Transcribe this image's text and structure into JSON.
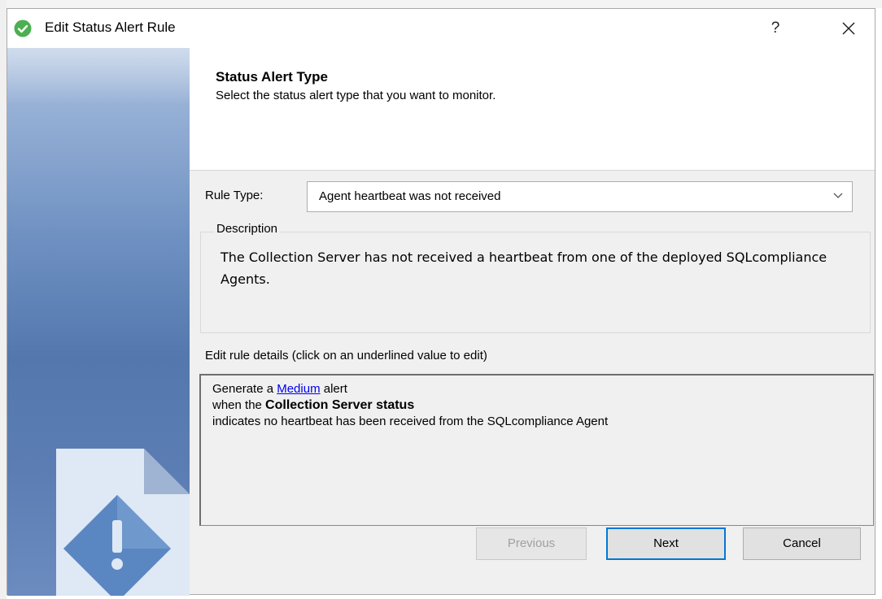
{
  "window": {
    "title": "Edit Status Alert Rule",
    "help_label": "?",
    "close_icon": "close-icon",
    "app_icon": "green-check-circle-icon"
  },
  "header": {
    "title": "Status Alert Type",
    "subtitle": "Select the status alert type that you want to monitor."
  },
  "rule_type": {
    "label": "Rule Type:",
    "selected": "Agent heartbeat was not received"
  },
  "description": {
    "legend": "Description",
    "text": "The Collection Server has not received a heartbeat from one of the deployed SQLcompliance Agents."
  },
  "edit_details": {
    "label": "Edit rule details (click on an underlined value to edit)",
    "line1_prefix": "Generate a ",
    "line1_link": "Medium",
    "line1_suffix": " alert",
    "line2_prefix": "when the ",
    "line2_bold": "Collection Server status",
    "line3": "indicates no heartbeat has been received from the SQLcompliance Agent"
  },
  "buttons": {
    "previous": "Previous",
    "next": "Next",
    "cancel": "Cancel"
  },
  "colors": {
    "accent": "#0078d7",
    "link": "#0000ee",
    "panel_blue": "#5478ae",
    "app_icon_green": "#4caf50"
  }
}
